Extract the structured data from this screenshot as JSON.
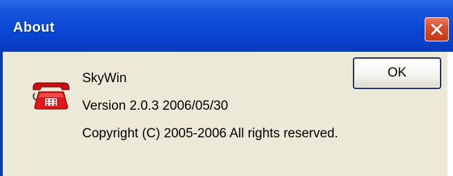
{
  "window": {
    "title": "About",
    "title_bar_color": "#0a48d8",
    "close_button_color": "#d84a24"
  },
  "app": {
    "icon": "red-telephone-icon",
    "name": "SkyWin",
    "version": "Version 2.0.3  2006/05/30",
    "copyright": "Copyright (C) 2005-2006 All rights reserved."
  },
  "buttons": {
    "ok_label": "OK",
    "close_icon": "close-icon"
  },
  "colors": {
    "dialog_background": "#ece9d8"
  }
}
